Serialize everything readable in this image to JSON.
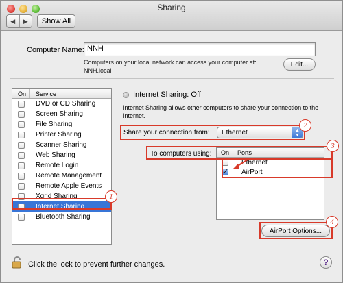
{
  "window": {
    "title": "Sharing",
    "nav_back": "◀",
    "nav_forward": "▶",
    "show_all": "Show All"
  },
  "computer": {
    "label": "Computer Name:",
    "value": "NNH",
    "desc_line1": "Computers on your local network can access your computer at:",
    "desc_line2": "NNH.local",
    "edit_label": "Edit..."
  },
  "services": {
    "header_on": "On",
    "header_service": "Service",
    "items": [
      {
        "label": "DVD or CD Sharing",
        "checked": false
      },
      {
        "label": "Screen Sharing",
        "checked": false
      },
      {
        "label": "File Sharing",
        "checked": false
      },
      {
        "label": "Printer Sharing",
        "checked": false
      },
      {
        "label": "Scanner Sharing",
        "checked": false
      },
      {
        "label": "Web Sharing",
        "checked": false
      },
      {
        "label": "Remote Login",
        "checked": false
      },
      {
        "label": "Remote Management",
        "checked": false
      },
      {
        "label": "Remote Apple Events",
        "checked": false
      },
      {
        "label": "Xgrid Sharing",
        "checked": false
      },
      {
        "label": "Internet Sharing",
        "checked": false,
        "selected": true
      },
      {
        "label": "Bluetooth Sharing",
        "checked": false
      }
    ]
  },
  "detail": {
    "status": "Internet Sharing: Off",
    "description": "Internet Sharing allows other computers to share your connection to the Internet.",
    "share_from_label": "Share your connection from:",
    "share_from_value": "Ethernet",
    "to_computers_label": "To computers using:",
    "ports_header_on": "On",
    "ports_header_ports": "Ports",
    "ports": [
      {
        "label": "Ethernet",
        "checked": false
      },
      {
        "label": "AirPort",
        "checked": true
      }
    ],
    "airport_options_label": "AirPort Options..."
  },
  "footer": {
    "lock_text": "Click the lock to prevent further changes.",
    "help": "?"
  },
  "annotations": {
    "step1": "1",
    "step2": "2",
    "step3": "3",
    "step4": "4",
    "color": "#d83a2a"
  },
  "colors": {
    "selection": "#3875d7",
    "window_bg": "#ececec"
  }
}
